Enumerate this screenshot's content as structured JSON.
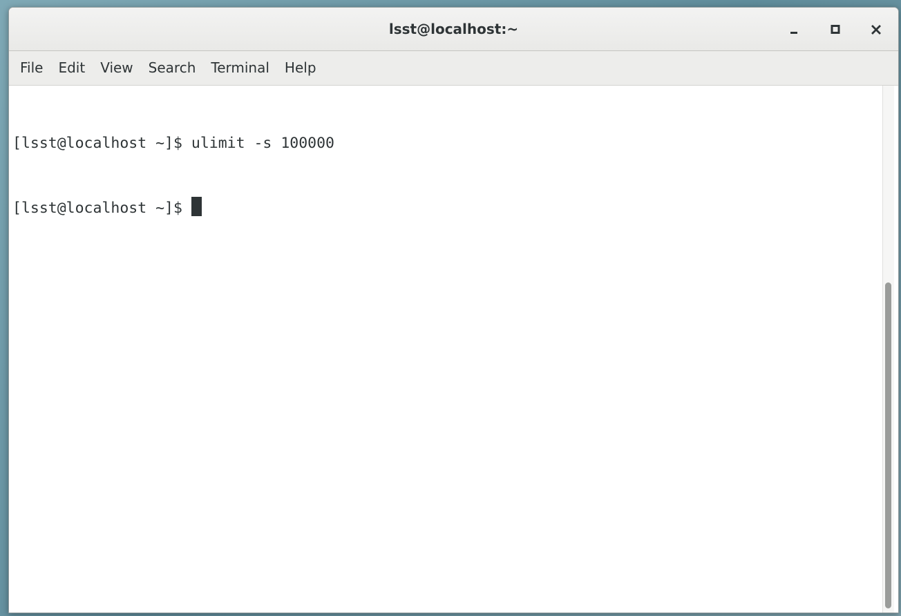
{
  "window": {
    "title": "lsst@localhost:~"
  },
  "window_controls": {
    "minimize_icon": "minimize-icon",
    "maximize_icon": "maximize-icon",
    "close_icon": "close-icon"
  },
  "menu": {
    "items": [
      "File",
      "Edit",
      "View",
      "Search",
      "Terminal",
      "Help"
    ]
  },
  "terminal": {
    "lines": [
      "[lsst@localhost ~]$ ulimit -s 100000",
      "[lsst@localhost ~]$ "
    ]
  },
  "colors": {
    "text": "#2e3436",
    "background": "#ffffff",
    "menubar": "#ededeb"
  }
}
